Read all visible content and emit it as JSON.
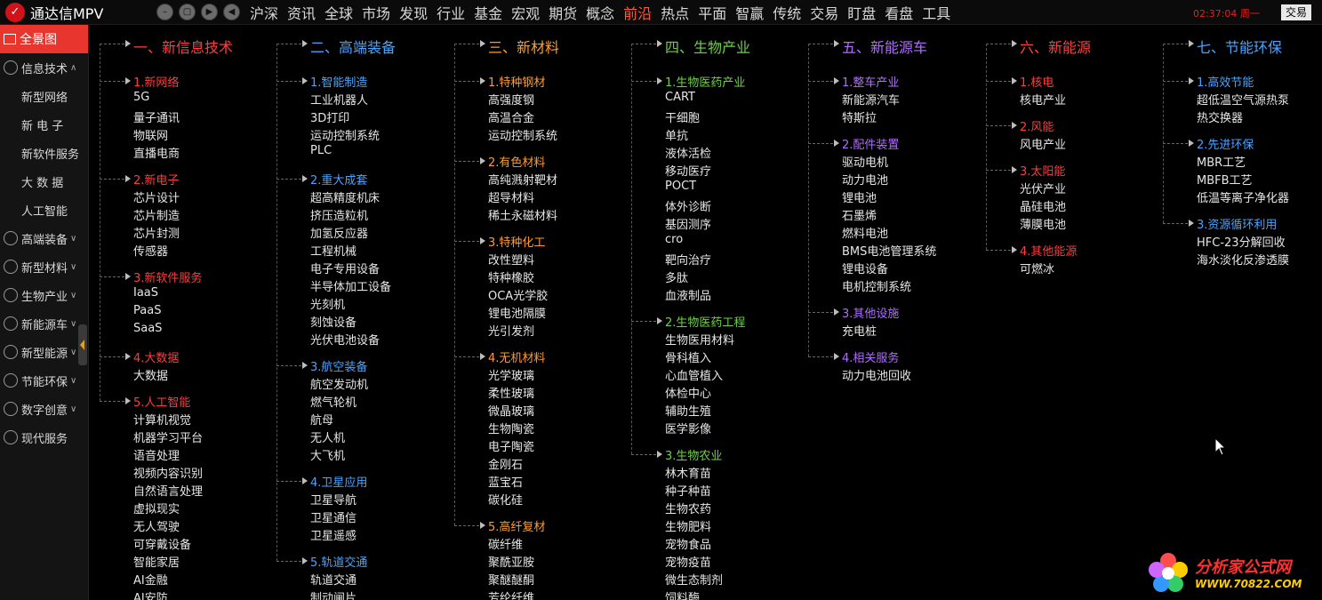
{
  "app": {
    "logo_glyph": "✓",
    "title": "通达信MPV"
  },
  "window_buttons": [
    "–",
    "▢",
    "▶",
    "◀"
  ],
  "top_menu": [
    {
      "label": "沪深",
      "hot": false
    },
    {
      "label": "资讯",
      "hot": false
    },
    {
      "label": "全球",
      "hot": false
    },
    {
      "label": "市场",
      "hot": false
    },
    {
      "label": "发现",
      "hot": false
    },
    {
      "label": "行业",
      "hot": false
    },
    {
      "label": "基金",
      "hot": false
    },
    {
      "label": "宏观",
      "hot": false
    },
    {
      "label": "期货",
      "hot": false
    },
    {
      "label": "概念",
      "hot": false
    },
    {
      "label": "前沿",
      "hot": true
    },
    {
      "label": "热点",
      "hot": false
    },
    {
      "label": "平面",
      "hot": false
    },
    {
      "label": "智赢",
      "hot": false
    },
    {
      "label": "传统",
      "hot": false
    },
    {
      "label": "交易",
      "hot": false
    },
    {
      "label": "盯盘",
      "hot": false
    },
    {
      "label": "看盘",
      "hot": false
    },
    {
      "label": "工具",
      "hot": false
    }
  ],
  "clock": "02:37:04 周一",
  "trade_button": "交易",
  "sidebar": {
    "top": "全景图",
    "items": [
      {
        "label": "信息技术",
        "chevron": "^",
        "expanded": true,
        "subs": [
          "新型网络",
          "新 电 子",
          "新软件服务",
          "大 数 据",
          "人工智能"
        ]
      },
      {
        "label": "高端装备",
        "chevron": "v",
        "subs": []
      },
      {
        "label": "新型材料",
        "chevron": "v",
        "subs": []
      },
      {
        "label": "生物产业",
        "chevron": "v",
        "subs": []
      },
      {
        "label": "新能源车",
        "chevron": "v",
        "subs": []
      },
      {
        "label": "新型能源",
        "chevron": "v",
        "subs": []
      },
      {
        "label": "节能环保",
        "chevron": "v",
        "subs": []
      },
      {
        "label": "数字创意",
        "chevron": "v",
        "subs": []
      },
      {
        "label": "现代服务",
        "chevron": "",
        "subs": []
      }
    ]
  },
  "columns": [
    {
      "title": "一、新信息技术",
      "color": "#ff3d3d",
      "sec_color": "#ff3d3d",
      "sections": [
        {
          "title": "1.新网络",
          "items": [
            "5G",
            "量子通讯",
            "物联网",
            "直播电商"
          ]
        },
        {
          "title": "2.新电子",
          "items": [
            "芯片设计",
            "芯片制造",
            "芯片封测",
            "传感器"
          ]
        },
        {
          "title": "3.新软件服务",
          "items": [
            "IaaS",
            "PaaS",
            "SaaS"
          ]
        },
        {
          "title": "4.大数据",
          "items": [
            "大数据"
          ]
        },
        {
          "title": "5.人工智能",
          "items": [
            "计算机视觉",
            "机器学习平台",
            "语音处理",
            "视频内容识别",
            "自然语言处理",
            "虚拟现实",
            "无人驾驶",
            "可穿戴设备",
            "智能家居",
            "AI金融",
            "AI安防"
          ]
        }
      ]
    },
    {
      "title": "二、高端装备",
      "color": "#4aa3ff",
      "sec_color": "#4aa3ff",
      "sections": [
        {
          "title": "1.智能制造",
          "items": [
            "工业机器人",
            "3D打印",
            "运动控制系统",
            "PLC"
          ]
        },
        {
          "title": "2.重大成套",
          "items": [
            "超高精度机床",
            "挤压造粒机",
            "加氢反应器",
            "工程机械",
            "电子专用设备",
            "半导体加工设备",
            "光刻机",
            "刻蚀设备",
            "光伏电池设备"
          ]
        },
        {
          "title": "3.航空装备",
          "items": [
            "航空发动机",
            "燃气轮机",
            "航母",
            "无人机",
            "大飞机"
          ]
        },
        {
          "title": "4.卫星应用",
          "items": [
            "卫星导航",
            "卫星通信",
            "卫星遥感"
          ]
        },
        {
          "title": "5.轨道交通",
          "items": [
            "轨道交通",
            "制动闸片"
          ]
        }
      ]
    },
    {
      "title": "三、新材料",
      "color": "#ff9a2e",
      "sec_color": "#ff9a2e",
      "sections": [
        {
          "title": "1.特种钢材",
          "items": [
            "高强度钢",
            "高温合金",
            "运动控制系统"
          ]
        },
        {
          "title": "2.有色材料",
          "items": [
            "高纯溅射靶材",
            "超导材料",
            "稀土永磁材料"
          ]
        },
        {
          "title": "3.特种化工",
          "items": [
            "改性塑料",
            "特种橡胶",
            "OCA光学胶",
            "锂电池隔膜",
            "光引发剂"
          ]
        },
        {
          "title": "4.无机材料",
          "items": [
            "光学玻璃",
            "柔性玻璃",
            "微晶玻璃",
            "生物陶瓷",
            "电子陶瓷",
            "金刚石",
            "蓝宝石",
            "碳化硅"
          ]
        },
        {
          "title": "5.高纤复材",
          "items": [
            "碳纤维",
            "聚酰亚胺",
            "聚醚醚酮",
            "芳纶纤维"
          ]
        }
      ]
    },
    {
      "title": "四、生物产业",
      "color": "#6fcf4a",
      "sec_color": "#6fcf4a",
      "sections": [
        {
          "title": "1.生物医药产业",
          "items": [
            "CART",
            "干细胞",
            "单抗",
            "液体活检",
            "移动医疗",
            "POCT",
            "体外诊断",
            "基因测序",
            "cro",
            "靶向治疗",
            "多肽",
            "血液制品"
          ]
        },
        {
          "title": "2.生物医药工程",
          "items": [
            "生物医用材料",
            "骨科植入",
            "心血管植入",
            "体检中心",
            "辅助生殖",
            "医学影像"
          ]
        },
        {
          "title": "3.生物农业",
          "items": [
            "林木育苗",
            "种子种苗",
            "生物农药",
            "生物肥料",
            "宠物食品",
            "宠物疫苗",
            "微生态制剂",
            "饲料酶"
          ]
        }
      ]
    },
    {
      "title": "五、新能源车",
      "color": "#b06cff",
      "sec_color": "#b06cff",
      "sections": [
        {
          "title": "1.整车产业",
          "items": [
            "新能源汽车",
            "特斯拉"
          ]
        },
        {
          "title": "2.配件装置",
          "items": [
            "驱动电机",
            "动力电池",
            "锂电池",
            "石墨烯",
            "燃料电池",
            "BMS电池管理系统",
            "锂电设备",
            "电机控制系统"
          ]
        },
        {
          "title": "3.其他设施",
          "items": [
            "充电桩"
          ]
        },
        {
          "title": "4.相关服务",
          "items": [
            "动力电池回收"
          ]
        }
      ]
    },
    {
      "title": "六、新能源",
      "color": "#ff3d3d",
      "sec_color": "#ff3d3d",
      "sections": [
        {
          "title": "1.核电",
          "items": [
            "核电产业"
          ]
        },
        {
          "title": "2.风能",
          "items": [
            "风电产业"
          ]
        },
        {
          "title": "3.太阳能",
          "items": [
            "光伏产业",
            "晶硅电池",
            "薄膜电池"
          ]
        },
        {
          "title": "4.其他能源",
          "items": [
            "可燃冰"
          ]
        }
      ]
    },
    {
      "title": "七、节能环保",
      "color": "#4aa3ff",
      "sec_color": "#4aa3ff",
      "sections": [
        {
          "title": "1.高效节能",
          "items": [
            "超低温空气源热泵",
            "热交换器"
          ]
        },
        {
          "title": "2.先进环保",
          "items": [
            "MBR工艺",
            "MBFB工艺",
            "低温等离子净化器"
          ]
        },
        {
          "title": "3.资源循环利用",
          "items": [
            "HFC-23分解回收",
            "海水淡化反渗透膜"
          ]
        }
      ]
    }
  ],
  "watermark": {
    "line1": "分析家公式网",
    "line2": "WWW.70822.COM"
  }
}
